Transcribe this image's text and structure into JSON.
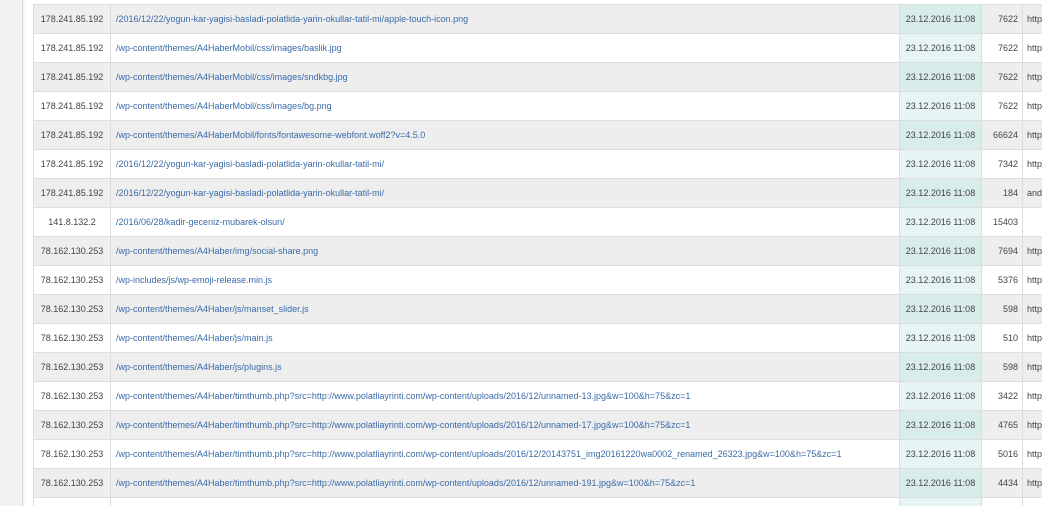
{
  "rows": [
    {
      "ip": "178.241.85.192",
      "path": "/2016/12/22/yogun-kar-yagisi-basladi-polatlida-yarin-okullar-tatil-mi/apple-touch-icon.png",
      "date": "23.12.2016 11:08",
      "size": "7622",
      "ref": "http:"
    },
    {
      "ip": "178.241.85.192",
      "path": "/wp-content/themes/A4HaberMobil/css/images/baslik.jpg",
      "date": "23.12.2016 11:08",
      "size": "7622",
      "ref": "http:"
    },
    {
      "ip": "178.241.85.192",
      "path": "/wp-content/themes/A4HaberMobil/css/images/sndkbg.jpg",
      "date": "23.12.2016 11:08",
      "size": "7622",
      "ref": "http:"
    },
    {
      "ip": "178.241.85.192",
      "path": "/wp-content/themes/A4HaberMobil/css/images/bg.png",
      "date": "23.12.2016 11:08",
      "size": "7622",
      "ref": "http:"
    },
    {
      "ip": "178.241.85.192",
      "path": "/wp-content/themes/A4HaberMobil/fonts/fontawesome-webfont.woff2?v=4.5.0",
      "date": "23.12.2016 11:08",
      "size": "66624",
      "ref": "http:"
    },
    {
      "ip": "178.241.85.192",
      "path": "/2016/12/22/yogun-kar-yagisi-basladi-polatlida-yarin-okullar-tatil-mi/",
      "date": "23.12.2016 11:08",
      "size": "7342",
      "ref": "http:"
    },
    {
      "ip": "178.241.85.192",
      "path": "/2016/12/22/yogun-kar-yagisi-basladi-polatlida-yarin-okullar-tatil-mi/",
      "date": "23.12.2016 11:08",
      "size": "184",
      "ref": "andr"
    },
    {
      "ip": "141.8.132.2",
      "path": "/2016/06/28/kadir-geceniz-mubarek-olsun/",
      "date": "23.12.2016 11:08",
      "size": "15403",
      "ref": ""
    },
    {
      "ip": "78.162.130.253",
      "path": "/wp-content/themes/A4Haber/img/social-share.png",
      "date": "23.12.2016 11:08",
      "size": "7694",
      "ref": "http:"
    },
    {
      "ip": "78.162.130.253",
      "path": "/wp-includes/js/wp-emoji-release.min.js",
      "date": "23.12.2016 11:08",
      "size": "5376",
      "ref": "http:"
    },
    {
      "ip": "78.162.130.253",
      "path": "/wp-content/themes/A4Haber/js/manset_slider.js",
      "date": "23.12.2016 11:08",
      "size": "598",
      "ref": "http:"
    },
    {
      "ip": "78.162.130.253",
      "path": "/wp-content/themes/A4Haber/js/main.js",
      "date": "23.12.2016 11:08",
      "size": "510",
      "ref": "http:"
    },
    {
      "ip": "78.162.130.253",
      "path": "/wp-content/themes/A4Haber/js/plugins.js",
      "date": "23.12.2016 11:08",
      "size": "598",
      "ref": "http:"
    },
    {
      "ip": "78.162.130.253",
      "path": "/wp-content/themes/A4Haber/timthumb.php?src=http://www.polatliayrinti.com/wp-content/uploads/2016/12/unnamed-13.jpg&w=100&h=75&zc=1",
      "date": "23.12.2016 11:08",
      "size": "3422",
      "ref": "http:"
    },
    {
      "ip": "78.162.130.253",
      "path": "/wp-content/themes/A4Haber/timthumb.php?src=http://www.polatliayrinti.com/wp-content/uploads/2016/12/unnamed-17.jpg&w=100&h=75&zc=1",
      "date": "23.12.2016 11:08",
      "size": "4765",
      "ref": "http:"
    },
    {
      "ip": "78.162.130.253",
      "path": "/wp-content/themes/A4Haber/timthumb.php?src=http://www.polatliayrinti.com/wp-content/uploads/2016/12/20143751_img20161220wa0002_renamed_26323.jpg&w=100&h=75&zc=1",
      "date": "23.12.2016 11:08",
      "size": "5016",
      "ref": "http:"
    },
    {
      "ip": "78.162.130.253",
      "path": "/wp-content/themes/A4Haber/timthumb.php?src=http://www.polatliayrinti.com/wp-content/uploads/2016/12/unnamed-191.jpg&w=100&h=75&zc=1",
      "date": "23.12.2016 11:08",
      "size": "4434",
      "ref": "http:"
    }
  ],
  "colors": {
    "link": "#3a6aa8",
    "row_odd": "#eeeeee",
    "row_even": "#ffffff",
    "date_highlight": "#d9ecec"
  }
}
